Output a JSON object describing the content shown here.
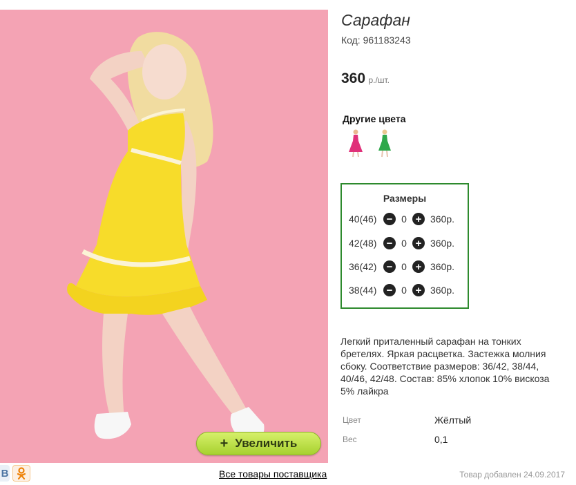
{
  "product": {
    "title": "Сарафан",
    "code": "Код: 961183243",
    "price": "360",
    "price_unit": "р./шт."
  },
  "zoom_button": {
    "plus": "+",
    "label": "Увеличить"
  },
  "other_colors": {
    "title": "Другие цвета",
    "items": [
      {
        "icon": "dress-thumbnail-pink",
        "color": "#e0317a"
      },
      {
        "icon": "dress-thumbnail-green",
        "color": "#2ea84a"
      }
    ]
  },
  "sizes": {
    "title": "Размеры",
    "rows": [
      {
        "label": "40(46)",
        "qty": "0",
        "price": "360р."
      },
      {
        "label": "42(48)",
        "qty": "0",
        "price": "360р."
      },
      {
        "label": "36(42)",
        "qty": "0",
        "price": "360р."
      },
      {
        "label": "38(44)",
        "qty": "0",
        "price": "360р."
      }
    ],
    "minus_icon": "−",
    "plus_icon": "+"
  },
  "description": "Легкий приталенный сарафан на тонких бретелях. Яркая расцветка. Застежка молния сбоку. Соответствие размеров: 36/42, 38/44, 40/46, 42/48. Состав: 85% хлопок 10% вискоза 5% лайкра",
  "attributes": [
    {
      "label": "Цвет",
      "value": "Жёлтый"
    },
    {
      "label": "Вес",
      "value": "0,1"
    }
  ],
  "social": {
    "vk": "B",
    "ok": "ok"
  },
  "supplier_link": "Все товары поставщика",
  "added_date": "Товар добавлен 24.09.2017",
  "colors": {
    "accent_green": "#2d8a2d",
    "button_green": "#b5dc3c",
    "photo_bg": "#f4a3b4",
    "dress_yellow": "#f7dc2a"
  }
}
